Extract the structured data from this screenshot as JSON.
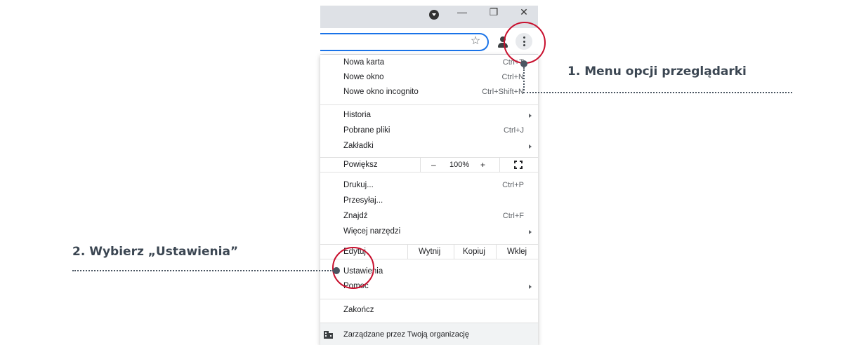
{
  "menu": {
    "new_tab": "Nowa karta",
    "new_tab_sc": "Ctrl+T",
    "new_window": "Nowe okno",
    "new_window_sc": "Ctrl+N",
    "incognito": "Nowe okno incognito",
    "incognito_sc": "Ctrl+Shift+N",
    "history": "Historia",
    "downloads": "Pobrane pliki",
    "downloads_sc": "Ctrl+J",
    "bookmarks": "Zakładki",
    "zoom_label": "Powiększ",
    "zoom_minus": "–",
    "zoom_value": "100%",
    "zoom_plus": "+",
    "print": "Drukuj...",
    "print_sc": "Ctrl+P",
    "cast": "Przesyłaj...",
    "find": "Znajdź",
    "find_sc": "Ctrl+F",
    "more_tools": "Więcej narzędzi",
    "edit_label": "Edytuj",
    "cut": "Wytnij",
    "copy": "Kopiuj",
    "paste": "Wklej",
    "settings": "Ustawienia",
    "help": "Pomoc",
    "exit": "Zakończ",
    "managed": "Zarządzane przez Twoją organizację"
  },
  "annotations": {
    "step1": "1. Menu opcji przeglądarki",
    "step2": "2. Wybierz „Ustawienia”"
  },
  "colors": {
    "accent": "#1a73e8",
    "annotation_red": "#c8102e",
    "annotation_text": "#3b4652"
  }
}
